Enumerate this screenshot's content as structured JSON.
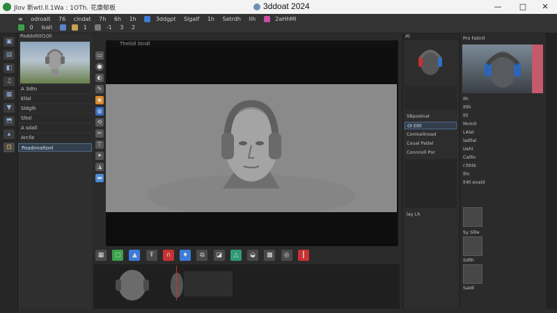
{
  "window": {
    "title": "3ddoat 2024",
    "menu_text": "Jlov   新wtl.ll.1Wa  : 1OTh.  花康郁板",
    "controls": [
      "—",
      "□",
      "✕"
    ]
  },
  "toolbar": {
    "row1": [
      "≡",
      "odroalt",
      "76",
      "cindat",
      "7h",
      "6h",
      "1h",
      "3ddgpt",
      "Slgalf",
      "1h",
      "Setrdh",
      "Ilh",
      "2aHhMl"
    ],
    "row2": [
      "0",
      "lsall",
      "1",
      "-1",
      "3",
      "2"
    ]
  },
  "left_panel": {
    "title": "Paddolt0l10ll",
    "rows": [
      "A 3dtn",
      "Ellol",
      "Sldglh",
      "Sltol",
      "A  sdall",
      "Arclle",
      "Poadnnaltonl"
    ]
  },
  "viewport": {
    "label": "Thelldl Stndl"
  },
  "right_panel": {
    "title": "Al",
    "rows": [
      "SBpostnat",
      "Ol Ellll",
      "Conloallnoad",
      "Coual Patlel",
      "Connnoll Por",
      "lay Lh"
    ]
  },
  "far_right": {
    "title": "Pro Fatlnll",
    "rows": [
      "Ilh",
      "llllh",
      "llll",
      "Mnlnll",
      "LAlal",
      "ladllal",
      "Uehl",
      "Calllo",
      "r.lthtk",
      "llln",
      "ll4ll  eoald",
      "Sy Sllle",
      "Sdllh",
      "Saldl"
    ]
  },
  "colors": {
    "titlebar": "#f3f3f3",
    "panel": "#2f2f2f",
    "viewport_bg": "#8a8a8a",
    "accent_blue": "#4f6d90",
    "accent_red": "#c83232"
  }
}
